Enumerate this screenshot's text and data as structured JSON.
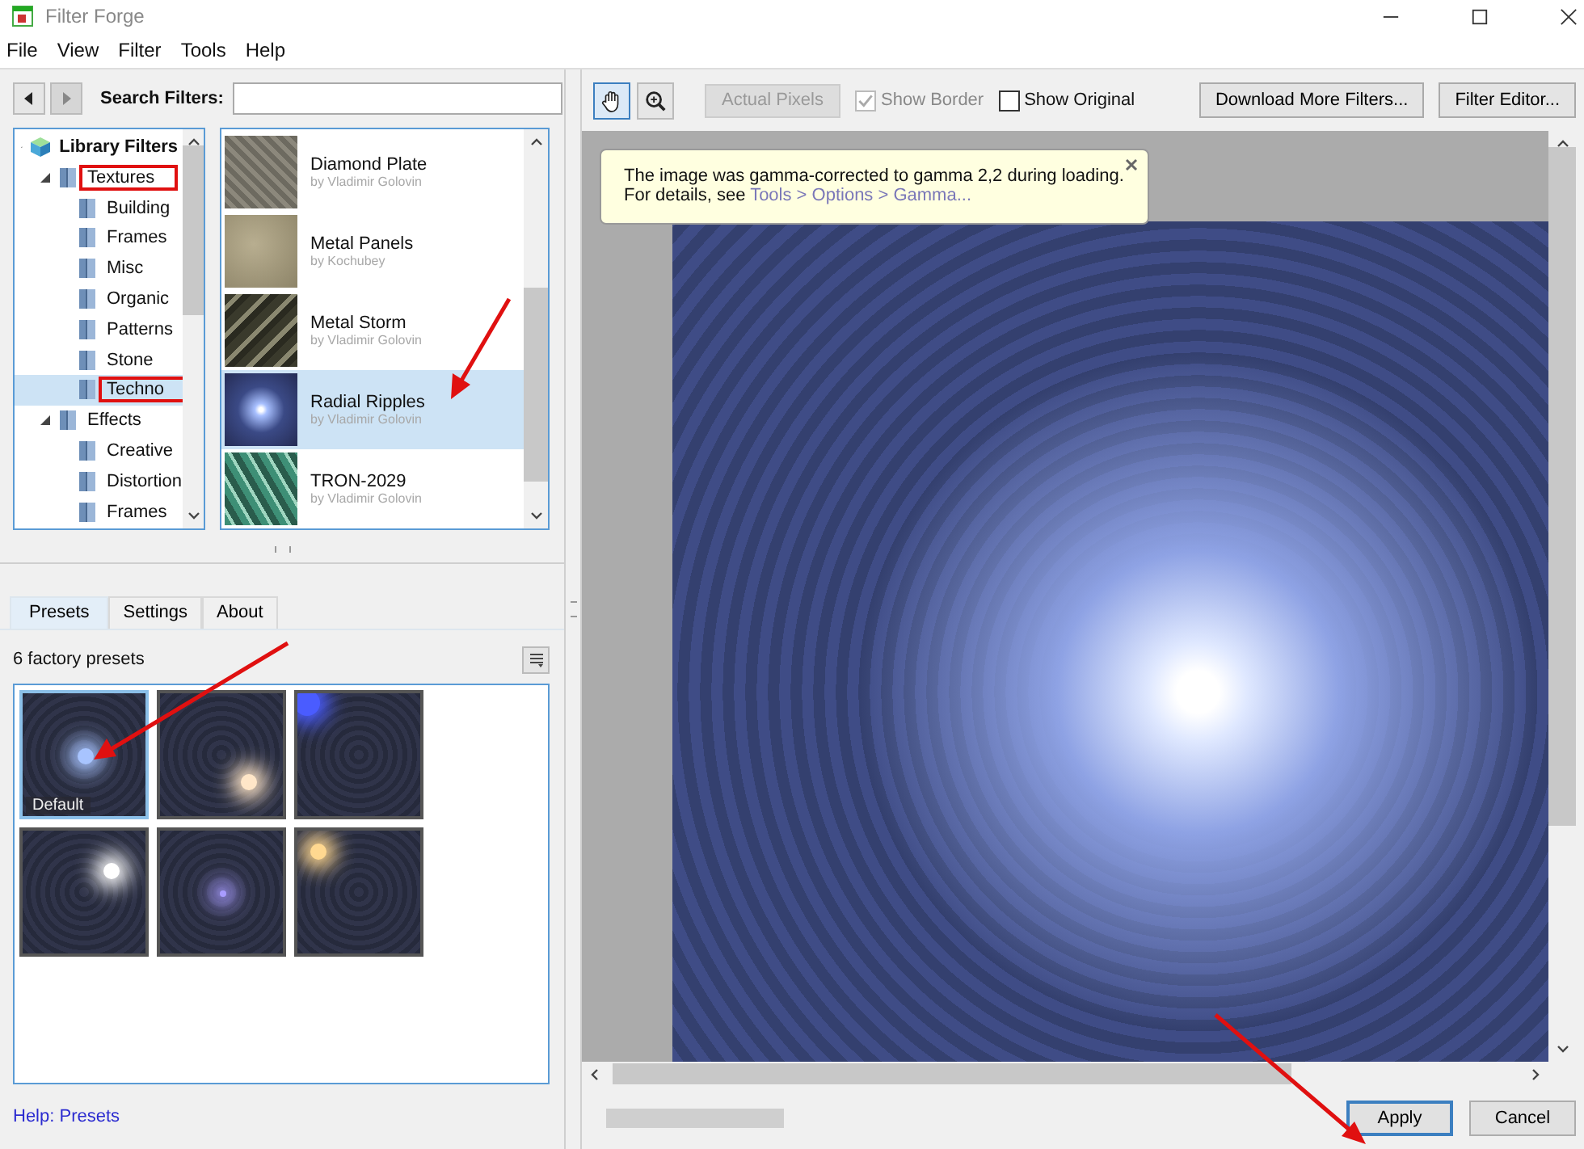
{
  "window": {
    "title": "Filter Forge"
  },
  "menu": [
    "File",
    "View",
    "Filter",
    "Tools",
    "Help"
  ],
  "search": {
    "label": "Search Filters:"
  },
  "tree": [
    {
      "label": "Library Filters",
      "kind": "library",
      "expanded": true,
      "selected": false,
      "annotated": false,
      "children": [
        {
          "label": "Textures",
          "kind": "folder",
          "expanded": true,
          "selected": false,
          "annotated": true,
          "children": [
            {
              "label": "Building",
              "kind": "folder",
              "selected": false,
              "annotated": false
            },
            {
              "label": "Frames",
              "kind": "folder",
              "selected": false,
              "annotated": false
            },
            {
              "label": "Misc",
              "kind": "folder",
              "selected": false,
              "annotated": false
            },
            {
              "label": "Organic",
              "kind": "folder",
              "selected": false,
              "annotated": false
            },
            {
              "label": "Patterns",
              "kind": "folder",
              "selected": false,
              "annotated": false
            },
            {
              "label": "Stone",
              "kind": "folder",
              "selected": false,
              "annotated": false
            },
            {
              "label": "Techno",
              "kind": "folder",
              "selected": true,
              "annotated": true
            }
          ]
        },
        {
          "label": "Effects",
          "kind": "folder",
          "expanded": true,
          "selected": false,
          "annotated": false,
          "children": [
            {
              "label": "Creative",
              "kind": "folder",
              "selected": false,
              "annotated": false
            },
            {
              "label": "Distortion",
              "kind": "folder",
              "selected": false,
              "annotated": false
            },
            {
              "label": "Frames",
              "kind": "folder",
              "selected": false,
              "annotated": false
            }
          ]
        }
      ]
    }
  ],
  "filters": [
    {
      "name": "Diamond Plate",
      "author": "by Vladimir Golovin",
      "kind": "diamond",
      "selected": false
    },
    {
      "name": "Metal Panels",
      "author": "by Kochubey",
      "kind": "panels",
      "selected": false
    },
    {
      "name": "Metal Storm",
      "author": "by Vladimir Golovin",
      "kind": "storm",
      "selected": false
    },
    {
      "name": "Radial Ripples",
      "author": "by Vladimir Golovin",
      "kind": "ripples",
      "selected": true
    },
    {
      "name": "TRON-2029",
      "author": "by Vladimir Golovin",
      "kind": "tron",
      "selected": false
    }
  ],
  "tabs": [
    {
      "label": "Presets",
      "selected": true
    },
    {
      "label": "Settings",
      "selected": false
    },
    {
      "label": "About",
      "selected": false
    }
  ],
  "presets": {
    "count": "6 factory presets",
    "items": [
      {
        "label": "Default",
        "kind": "center",
        "color": "#a8c4ff",
        "selected": true
      },
      {
        "kind": "lower-right",
        "color": "#ffe6c8",
        "selected": false
      },
      {
        "kind": "top-left",
        "color": "#4a5cff",
        "selected": false
      },
      {
        "kind": "upper-right",
        "color": "#ffffff",
        "selected": false
      },
      {
        "kind": "small-center",
        "color": "#a89cff",
        "selected": false
      },
      {
        "kind": "top-left-warm",
        "color": "#ffd890",
        "selected": false
      }
    ]
  },
  "help_link": "Help: Presets",
  "toolbar": {
    "tools": [
      {
        "kind": "hand",
        "selected": true
      },
      {
        "kind": "zoom",
        "selected": false
      }
    ],
    "actual_pixels": {
      "label": "Actual Pixels",
      "disabled": true
    },
    "show_border": {
      "label": "Show Border",
      "checked": true,
      "disabled": true
    },
    "show_original": {
      "label": "Show Original",
      "checked": false,
      "disabled": false
    },
    "buttons": [
      "Download More Filters...",
      "Filter Editor..."
    ]
  },
  "notice": {
    "line": "The image was gamma-corrected to gamma 2,2 during loading.",
    "prefix": "For details, see",
    "link": "Tools > Options > Gamma..."
  },
  "footer": {
    "progress": {
      "level": 0
    },
    "buttons": [
      {
        "label": "Apply",
        "default": true
      },
      {
        "label": "Cancel",
        "default": false
      }
    ]
  }
}
